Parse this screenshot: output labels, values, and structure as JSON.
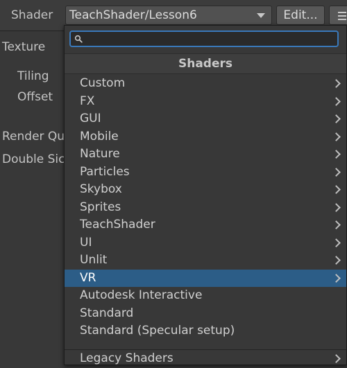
{
  "inspector": {
    "shader_label": "Shader",
    "shader_value": "TeachShader/Lesson6",
    "edit_label": "Edit...",
    "texture_label": "Texture",
    "tiling_label": "Tiling",
    "offset_label": "Offset",
    "render_queue_label": "Render Qu",
    "double_sided_label": "Double Sic"
  },
  "popup": {
    "search_value": "",
    "header": "Shaders",
    "items": [
      {
        "label": "Custom",
        "submenu": true
      },
      {
        "label": "FX",
        "submenu": true
      },
      {
        "label": "GUI",
        "submenu": true
      },
      {
        "label": "Mobile",
        "submenu": true
      },
      {
        "label": "Nature",
        "submenu": true
      },
      {
        "label": "Particles",
        "submenu": true
      },
      {
        "label": "Skybox",
        "submenu": true
      },
      {
        "label": "Sprites",
        "submenu": true
      },
      {
        "label": "TeachShader",
        "submenu": true
      },
      {
        "label": "UI",
        "submenu": true
      },
      {
        "label": "Unlit",
        "submenu": true
      },
      {
        "label": "VR",
        "submenu": true,
        "selected": true
      },
      {
        "label": "Autodesk Interactive",
        "submenu": false
      },
      {
        "label": "Standard",
        "submenu": false
      },
      {
        "label": "Standard (Specular setup)",
        "submenu": false
      }
    ],
    "legacy_item": {
      "label": "Legacy Shaders",
      "submenu": true
    }
  },
  "colors": {
    "background": "#383838",
    "selection": "#2c5d87",
    "search_focus": "#3a79bb"
  },
  "icons": [
    "search-icon",
    "chevron-right-icon",
    "dropdown-arrow-icon",
    "list-icon"
  ]
}
